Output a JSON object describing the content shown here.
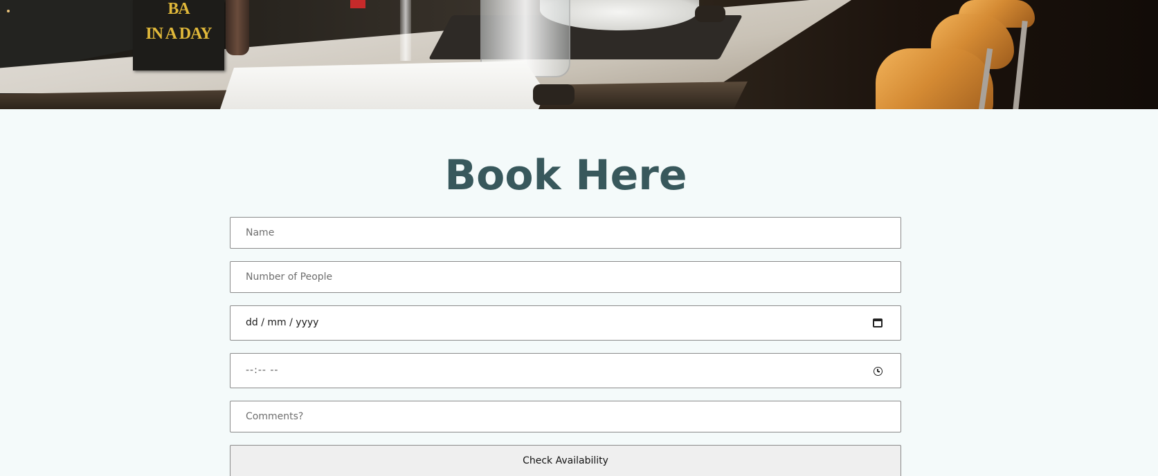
{
  "hero": {
    "image_label": "restaurant-bar-counter",
    "menu_card_lines": [
      "BA",
      "IN A DAY"
    ]
  },
  "booking": {
    "title": "Book Here",
    "fields": {
      "name_placeholder": "Name",
      "people_placeholder": "Number of People",
      "date_value": "dd / mm / yyyy",
      "time_value": "--:-- --",
      "comments_placeholder": "Comments?"
    },
    "submit_label": "Check Availability"
  },
  "colors": {
    "background": "#f4fafa",
    "title": "#38585c",
    "field_border": "#8a8a8a",
    "button_bg": "#efefef"
  },
  "icons": {
    "date": "calendar-icon",
    "time": "clock-icon"
  }
}
